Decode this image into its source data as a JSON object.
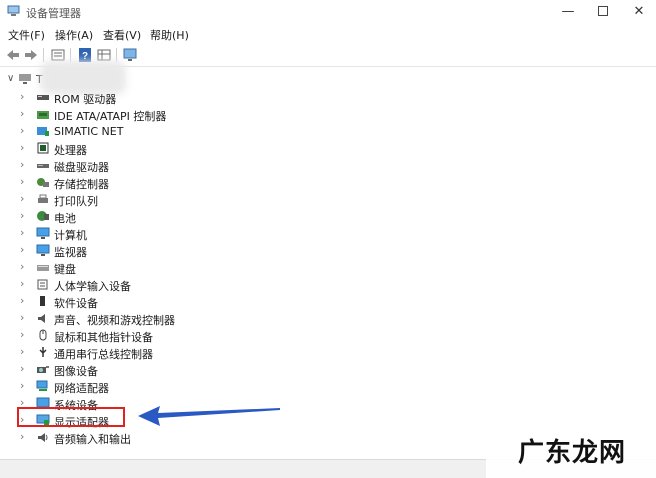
{
  "window": {
    "title": "设备管理器"
  },
  "menu": [
    "文件(F)",
    "操作(A)",
    "查看(V)",
    "帮助(H)"
  ],
  "toolbar": {
    "icons": [
      "back-arrow-icon",
      "forward-arrow-icon",
      "properties-icon",
      "help-icon",
      "grid-icon",
      "monitor-icon"
    ]
  },
  "tree": {
    "root_label": "T",
    "items": [
      {
        "label": "ROM 驱动器",
        "icon": "dvd-drive-icon"
      },
      {
        "label": "IDE ATA/ATAPI 控制器",
        "icon": "ide-controller-icon"
      },
      {
        "label": "SIMATIC NET",
        "icon": "network-card-icon"
      },
      {
        "label": "处理器",
        "icon": "processor-icon"
      },
      {
        "label": "磁盘驱动器",
        "icon": "disk-drive-icon"
      },
      {
        "label": "存储控制器",
        "icon": "storage-controller-icon"
      },
      {
        "label": "打印队列",
        "icon": "printer-icon"
      },
      {
        "label": "电池",
        "icon": "battery-icon"
      },
      {
        "label": "计算机",
        "icon": "computer-icon"
      },
      {
        "label": "监视器",
        "icon": "monitor-icon"
      },
      {
        "label": "键盘",
        "icon": "keyboard-icon"
      },
      {
        "label": "人体学输入设备",
        "icon": "hid-icon"
      },
      {
        "label": "软件设备",
        "icon": "software-device-icon"
      },
      {
        "label": "声音、视频和游戏控制器",
        "icon": "speaker-icon"
      },
      {
        "label": "鼠标和其他指针设备",
        "icon": "mouse-icon"
      },
      {
        "label": "通用串行总线控制器",
        "icon": "usb-icon"
      },
      {
        "label": "图像设备",
        "icon": "camera-icon"
      },
      {
        "label": "网络适配器",
        "icon": "network-adapter-icon"
      },
      {
        "label": "系统设备",
        "icon": "system-device-icon"
      },
      {
        "label": "显示适配器",
        "icon": "display-adapter-icon"
      },
      {
        "label": "音频输入和输出",
        "icon": "audio-io-icon"
      }
    ]
  },
  "watermark": "广东龙网",
  "colors": {
    "highlight": "#e1221f",
    "arrow": "#2b59c3"
  }
}
